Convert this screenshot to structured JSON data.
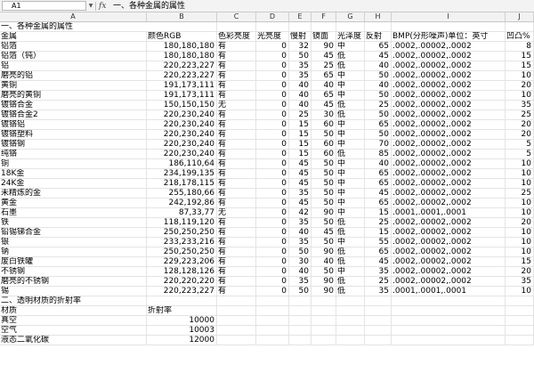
{
  "formula_bar": {
    "name_box": "A1",
    "fx_label": "fx",
    "value": "一、各种金属的属性"
  },
  "columns": [
    "A",
    "B",
    "C",
    "D",
    "E",
    "F",
    "G",
    "H",
    "I",
    "J"
  ],
  "rows": [
    [
      "一、各种金属的属性",
      "",
      "",
      "",
      "",
      "",
      "",
      "",
      "",
      ""
    ],
    [
      "金属",
      "颜色RGB",
      "色彩亮度",
      "光亮度",
      "慢射",
      "镜面",
      "光泽度",
      "反射",
      "BMP(分形噪声)单位：英寸",
      "凹凸%"
    ],
    [
      "铝箔",
      "180,180,180",
      "有",
      "0",
      "32",
      "90",
      "中",
      "65",
      ".0002,.00002,.0002",
      "8"
    ],
    [
      "铝箔（钝）",
      "180,180,180",
      "有",
      "0",
      "50",
      "45",
      "低",
      "45",
      ".0002,.00002,.0002",
      "15"
    ],
    [
      "铝",
      "220,223,227",
      "有",
      "0",
      "35",
      "25",
      "低",
      "40",
      ".0002,.00002,.0002",
      "15"
    ],
    [
      "磨亮的铝",
      "220,223,227",
      "有",
      "0",
      "35",
      "65",
      "中",
      "50",
      ".0002,.00002,.0002",
      "10"
    ],
    [
      "黄铜",
      "191,173,111",
      "有",
      "0",
      "40",
      "40",
      "中",
      "40",
      ".0002,.00002,.0002",
      "20"
    ],
    [
      "磨亮的黄铜",
      "191,173,111",
      "有",
      "0",
      "40",
      "65",
      "中",
      "50",
      ".0002,.00002,.0002",
      "10"
    ],
    [
      "镀铬合金",
      "150,150,150",
      "无",
      "0",
      "40",
      "45",
      "低",
      "25",
      ".0002,.00002,.0002",
      "35"
    ],
    [
      "镀铬合金2",
      "220,230,240",
      "有",
      "0",
      "25",
      "30",
      "低",
      "50",
      ".0002,.00002,.0002",
      "25"
    ],
    [
      "镀铬铝",
      "220,230,240",
      "有",
      "0",
      "15",
      "60",
      "中",
      "65",
      ".0002,.00002,.0002",
      "20"
    ],
    [
      "镀铬塑料",
      "220,230,240",
      "有",
      "0",
      "15",
      "50",
      "中",
      "50",
      ".0002,.00002,.0002",
      "20"
    ],
    [
      "镀铬钢",
      "220,230,240",
      "有",
      "0",
      "15",
      "60",
      "中",
      "70",
      ".0002,.00002,.0002",
      "5"
    ],
    [
      "纯铬",
      "220,230,240",
      "有",
      "0",
      "15",
      "60",
      "低",
      "85",
      ".0002,.00002,.0002",
      "5"
    ],
    [
      "铜",
      "186,110,64",
      "有",
      "0",
      "45",
      "50",
      "中",
      "40",
      ".0002,.00002,.0002",
      "10"
    ],
    [
      "18K金",
      "234,199,135",
      "有",
      "0",
      "45",
      "50",
      "中",
      "65",
      ".0002,.00002,.0002",
      "10"
    ],
    [
      "24K金",
      "218,178,115",
      "有",
      "0",
      "45",
      "50",
      "中",
      "65",
      ".0002,.00002,.0002",
      "10"
    ],
    [
      "未精炼的金",
      "255,180,66",
      "有",
      "0",
      "35",
      "50",
      "中",
      "45",
      ".0002,.00002,.0002",
      "25"
    ],
    [
      "黄金",
      "242,192,86",
      "有",
      "0",
      "45",
      "50",
      "中",
      "65",
      ".0002,.00002,.0002",
      "10"
    ],
    [
      "石墨",
      "87,33,77",
      "无",
      "0",
      "42",
      "90",
      "中",
      "15",
      ".0001,.0001,.0001",
      "10"
    ],
    [
      "铁",
      "118,119,120",
      "有",
      "0",
      "35",
      "50",
      "低",
      "25",
      ".0002,.00002,.0002",
      "20"
    ],
    [
      "铅锡锑合金",
      "250,250,250",
      "有",
      "0",
      "40",
      "45",
      "低",
      "15",
      ".0002,.00002,.0002",
      "10"
    ],
    [
      "银",
      "233,233,216",
      "有",
      "0",
      "35",
      "50",
      "中",
      "55",
      ".0002,.00002,.0002",
      "10"
    ],
    [
      "钠",
      "250,250,250",
      "有",
      "0",
      "50",
      "90",
      "低",
      "65",
      ".0002,.00002,.0002",
      "10"
    ],
    [
      "废白铁罐",
      "229,223,206",
      "有",
      "0",
      "30",
      "40",
      "低",
      "45",
      ".0002,.00002,.0002",
      "15"
    ],
    [
      "不锈钢",
      "128,128,126",
      "有",
      "0",
      "40",
      "50",
      "中",
      "35",
      ".0002,.00002,.0002",
      "20"
    ],
    [
      "磨亮的不锈钢",
      "220,220,220",
      "有",
      "0",
      "35",
      "90",
      "低",
      "25",
      ".0002,.00002,.0002",
      "35"
    ],
    [
      "锡",
      "220,223,227",
      "有",
      "0",
      "50",
      "90",
      "低",
      "35",
      ".0001,.0001,.0001",
      "10"
    ],
    [
      "二、透明材质的折射率",
      "",
      "",
      "",
      "",
      "",
      "",
      "",
      "",
      ""
    ],
    [
      "材质",
      "折射率",
      "",
      "",
      "",
      "",
      "",
      "",
      "",
      ""
    ],
    [
      "真空",
      "10000",
      "",
      "",
      "",
      "",
      "",
      "",
      "",
      ""
    ],
    [
      "空气",
      "10003",
      "",
      "",
      "",
      "",
      "",
      "",
      "",
      ""
    ],
    [
      "液态二氧化碳",
      "12000",
      "",
      "",
      "",
      "",
      "",
      "",
      "",
      ""
    ]
  ]
}
